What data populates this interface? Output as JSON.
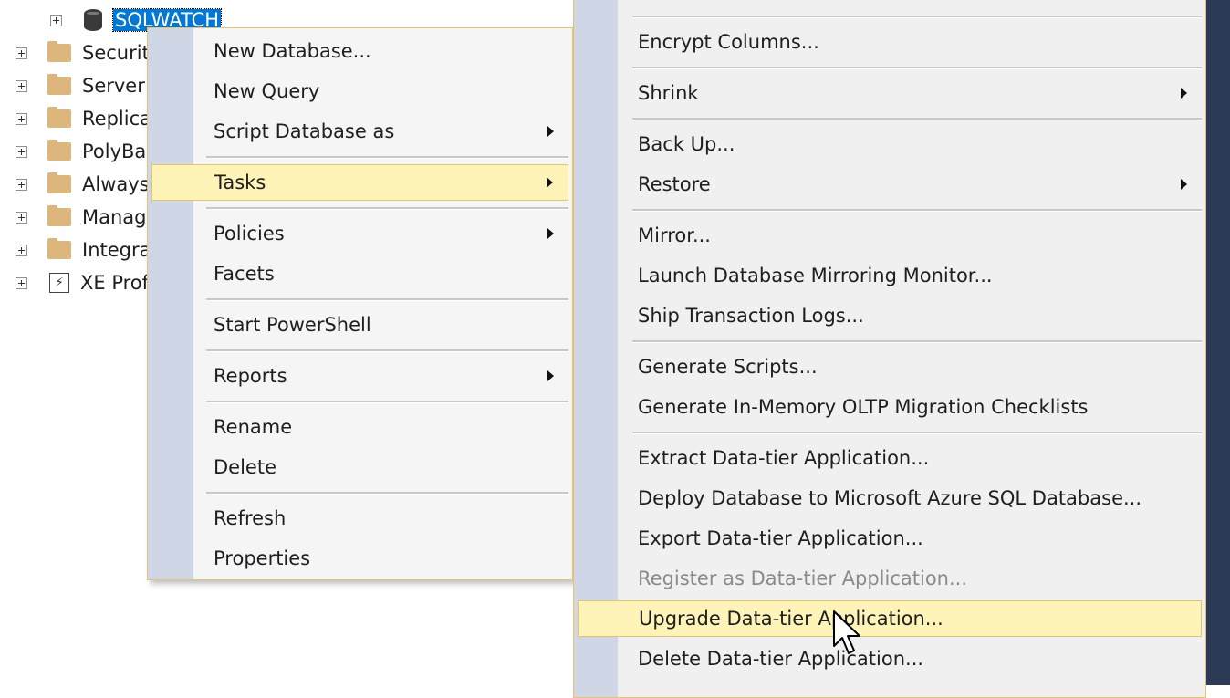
{
  "tree": {
    "selected_db": "SQLWATCH",
    "nodes": [
      {
        "label": "Security",
        "icon": "folder-icon"
      },
      {
        "label": "Server O",
        "icon": "folder-icon"
      },
      {
        "label": "Replica",
        "icon": "folder-icon"
      },
      {
        "label": "PolyBa",
        "icon": "folder-icon"
      },
      {
        "label": "Always",
        "icon": "folder-icon"
      },
      {
        "label": "Manag",
        "icon": "folder-icon"
      },
      {
        "label": "Integra",
        "icon": "folder-icon"
      },
      {
        "label": "XE Prof",
        "icon": "xe-profiler-icon"
      }
    ]
  },
  "context_menu": {
    "items": [
      {
        "label": "New Database...",
        "submenu": false
      },
      {
        "label": "New Query",
        "submenu": false
      },
      {
        "label": "Script Database as",
        "submenu": true
      },
      {
        "label": "Tasks",
        "submenu": true,
        "highlighted": true
      },
      {
        "label": "Policies",
        "submenu": true
      },
      {
        "label": "Facets",
        "submenu": false
      },
      {
        "label": "Start PowerShell",
        "submenu": false
      },
      {
        "label": "Reports",
        "submenu": true
      },
      {
        "label": "Rename",
        "submenu": false
      },
      {
        "label": "Delete",
        "submenu": false
      },
      {
        "label": "Refresh",
        "submenu": false
      },
      {
        "label": "Properties",
        "submenu": false
      }
    ]
  },
  "tasks_menu": {
    "items": [
      {
        "label": "Encrypt Columns...",
        "submenu": false
      },
      {
        "label": "Shrink",
        "submenu": true
      },
      {
        "label": "Back Up...",
        "submenu": false
      },
      {
        "label": "Restore",
        "submenu": true
      },
      {
        "label": "Mirror...",
        "submenu": false
      },
      {
        "label": "Launch Database Mirroring Monitor...",
        "submenu": false
      },
      {
        "label": "Ship Transaction Logs...",
        "submenu": false
      },
      {
        "label": "Generate Scripts...",
        "submenu": false
      },
      {
        "label": "Generate In-Memory OLTP Migration Checklists",
        "submenu": false
      },
      {
        "label": "Extract Data-tier Application...",
        "submenu": false
      },
      {
        "label": "Deploy Database to Microsoft Azure SQL Database...",
        "submenu": false
      },
      {
        "label": "Export Data-tier Application...",
        "submenu": false
      },
      {
        "label": "Register as Data-tier Application...",
        "submenu": false,
        "disabled": true
      },
      {
        "label": "Upgrade Data-tier Application...",
        "submenu": false,
        "highlighted": true
      },
      {
        "label": "Delete Data-tier Application...",
        "submenu": false
      }
    ]
  },
  "colors": {
    "menu_highlight": "#fff4b8",
    "menu_border": "#e8c36f",
    "selection": "#0078d7",
    "gutter": "#cfd6e5"
  }
}
